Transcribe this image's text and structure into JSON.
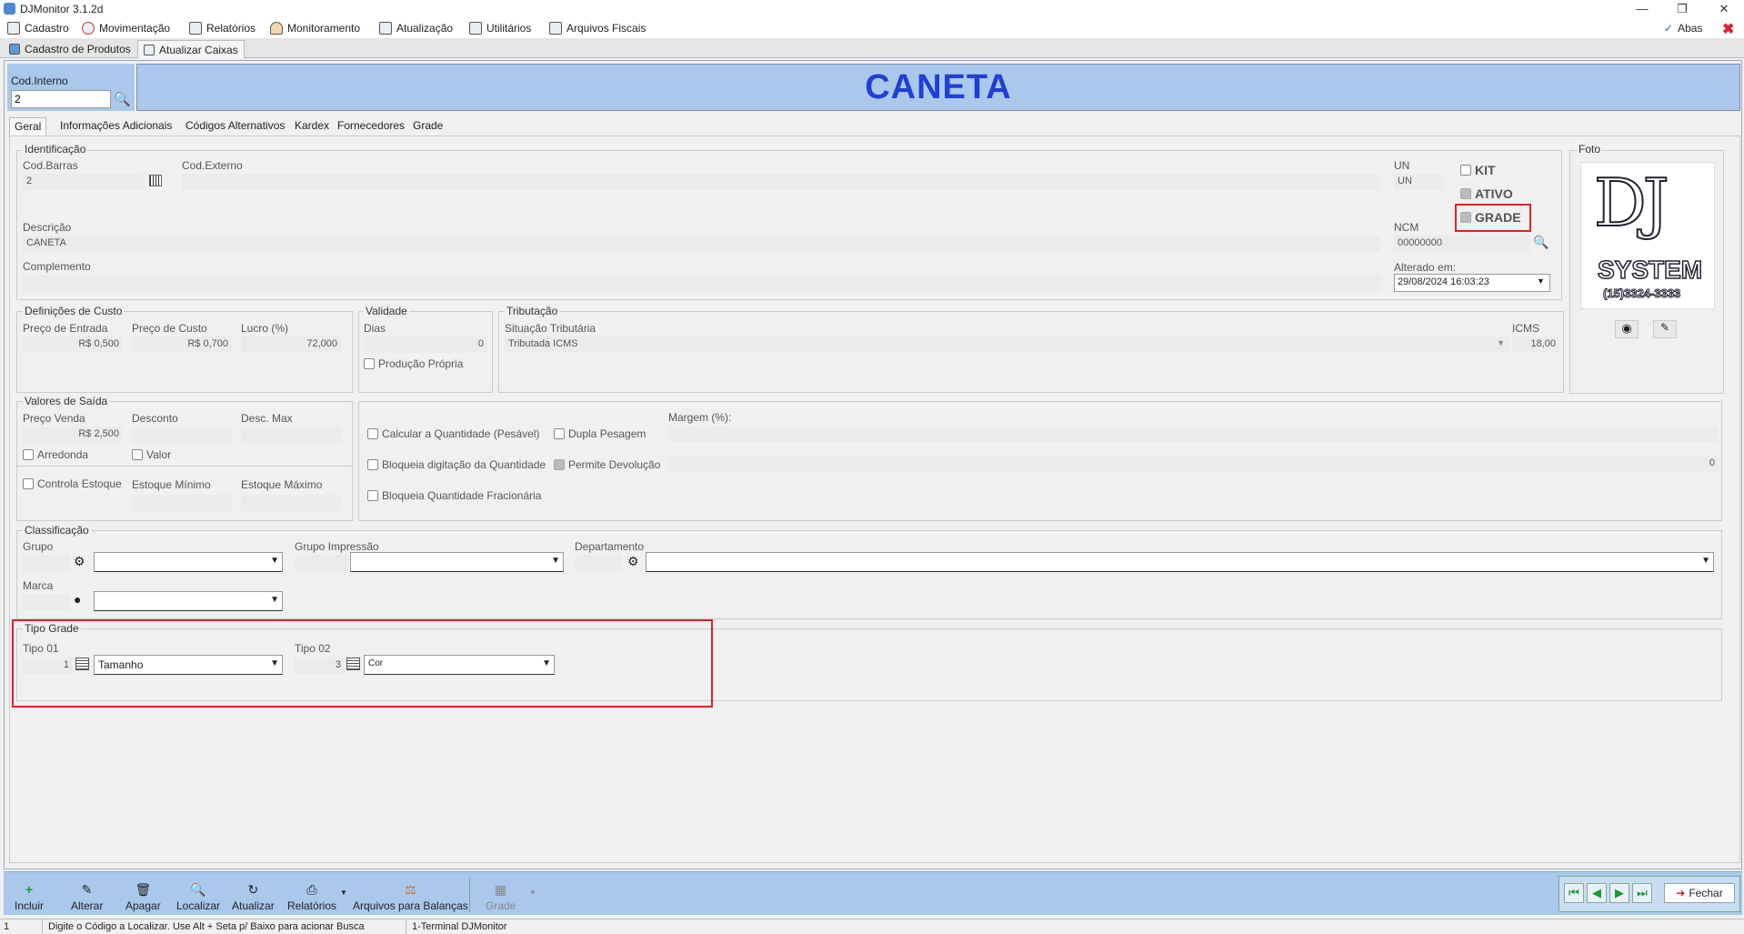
{
  "window": {
    "title": "DJMonitor 3.1.2d"
  },
  "menu": {
    "items": [
      {
        "label": "Cadastro",
        "icon": "list-icon"
      },
      {
        "label": "Movimentação",
        "icon": "cycle-icon"
      },
      {
        "label": "Relatórios",
        "icon": "printer-icon"
      },
      {
        "label": "Monitoramento",
        "icon": "person-icon"
      },
      {
        "label": "Atualização",
        "icon": "update-icon"
      },
      {
        "label": "Utilitários",
        "icon": "tools-icon"
      },
      {
        "label": "Arquivos Fiscais",
        "icon": "document-icon"
      }
    ],
    "abas_label": "Abas"
  },
  "page_tabs": [
    {
      "label": "Cadastro de Produtos"
    },
    {
      "label": "Atualizar Caixas"
    }
  ],
  "cod_interno": {
    "label": "Cod.Interno",
    "value": "2"
  },
  "banner": {
    "title": "CANETA"
  },
  "sub_tabs": [
    "Geral",
    "Informações Adicionais",
    "Códigos Alternativos",
    "Kardex",
    "Fornecedores",
    "Grade"
  ],
  "identificacao": {
    "title": "Identificação",
    "cod_barras_label": "Cod.Barras",
    "cod_barras_value": "2",
    "cod_externo_label": "Cod.Externo",
    "cod_externo_value": "",
    "un_label": "UN",
    "un_value": "UN",
    "kit_label": "KIT",
    "ativo_label": "ATIVO",
    "grade_label": "GRADE",
    "descricao_label": "Descrição",
    "descricao_value": "CANETA",
    "ncm_label": "NCM",
    "ncm_value": "00000000",
    "complemento_label": "Complemento",
    "complemento_value": "",
    "alterado_label": "Alterado em:",
    "alterado_value": "29/08/2024   16:03:23"
  },
  "foto": {
    "title": "Foto",
    "logo_line1": "DJ",
    "logo_line2": "SYSTEM",
    "logo_phone": "(15)3324-3333"
  },
  "custo": {
    "title": "Definições de Custo",
    "preco_entrada_label": "Preço de Entrada",
    "preco_entrada_value": "R$ 0,500",
    "preco_custo_label": "Preço de Custo",
    "preco_custo_value": "R$ 0,700",
    "lucro_label": "Lucro (%)",
    "lucro_value": "72,000"
  },
  "validade": {
    "title": "Validade",
    "dias_label": "Dias",
    "dias_value": "0",
    "producao_label": "Produção Própria"
  },
  "tributacao": {
    "title": "Tributação",
    "situacao_label": "Situação Tributária",
    "situacao_value": "Tributada ICMS",
    "icms_label": "ICMS",
    "icms_value": "18,00"
  },
  "saida": {
    "title": "Valores de Saída",
    "preco_venda_label": "Preço Venda",
    "preco_venda_value": "R$ 2,500",
    "desconto_label": "Desconto",
    "desc_max_label": "Desc. Max",
    "arredonda_label": "Arredonda",
    "valor_label": "Valor",
    "controla_estoque_label": "Controla Estoque",
    "estoque_minimo_label": "Estoque Mínimo",
    "estoque_maximo_label": "Estoque Máximo",
    "calcular_label": "Calcular a Quantidade (Pesável)",
    "dupla_label": "Dupla Pesagem",
    "bloqueia_dig_label": "Bloqueia digitação da Quantidade",
    "permite_dev_label": "Permite Devolução",
    "bloqueia_frac_label": "Bloqueia Quantidade Fracionária",
    "margem_label": "Margem (%):",
    "margem_value2": "0"
  },
  "classificacao": {
    "title": "Classificação",
    "grupo_label": "Grupo",
    "grupo_impressao_label": "Grupo Impressão",
    "departamento_label": "Departamento",
    "marca_label": "Marca"
  },
  "tipo_grade": {
    "title": "Tipo Grade",
    "tipo01_label": "Tipo 01",
    "tipo01_code": "1",
    "tipo01_value": "Tamanho",
    "tipo02_label": "Tipo 02",
    "tipo02_code": "3",
    "tipo02_value": "Cor"
  },
  "toolbar": {
    "buttons": [
      {
        "label": "Incluir"
      },
      {
        "label": "Alterar"
      },
      {
        "label": "Apagar"
      },
      {
        "label": "Localizar"
      },
      {
        "label": "Atualizar"
      },
      {
        "label": "Relatórios"
      },
      {
        "label": "Arquivos para Balanças"
      },
      {
        "label": "Grade"
      }
    ],
    "fechar_label": "Fechar"
  },
  "status": {
    "left": "1",
    "hint": "Digite o Código a Localizar. Use Alt + Seta p/ Baixo para acionar Busca",
    "terminal": "1-Terminal DJMonitor"
  },
  "colors": {
    "banner_bg": "#a9c8ec",
    "title_blue": "#1f3fd6",
    "highlight_red": "#e0202a"
  }
}
